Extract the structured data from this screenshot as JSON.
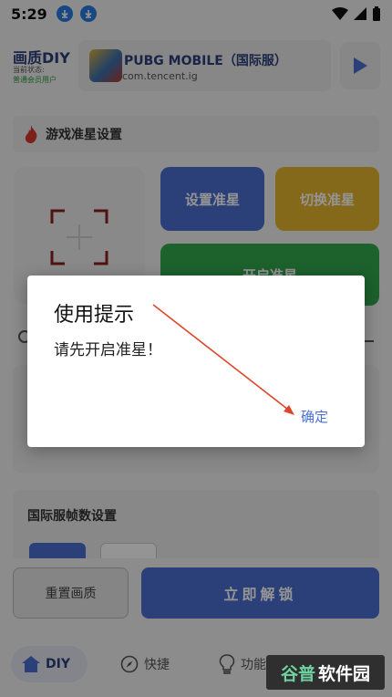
{
  "status_bar": {
    "time": "5:29"
  },
  "header": {
    "brand_title": "画质DIY",
    "brand_status_label": "当前状态:",
    "brand_status_value": "普通会员用户",
    "game_name": "PUBG MOBILE（国际服）",
    "game_package": "com.tencent.ig"
  },
  "crosshair_section": {
    "title": "游戏准星设置",
    "set_label": "设置准星",
    "switch_label": "切换准星",
    "open_label": "开启准星"
  },
  "fps_section": {
    "title": "国际服帧数设置"
  },
  "action_bar": {
    "reset_label": "重置画质",
    "unlock_label": "立即解锁"
  },
  "bottom_nav": {
    "diy": "DIY",
    "quick": "快捷",
    "func": "功能"
  },
  "dialog": {
    "title": "使用提示",
    "message": "请先开启准星！",
    "ok_label": "确定"
  },
  "watermark": {
    "text_a": "谷普",
    "text_b": "软件园"
  },
  "colors": {
    "accent": "#4a6fcf",
    "switch": "#e6b52e",
    "open": "#33a84f",
    "annotation": "#e0442a"
  }
}
